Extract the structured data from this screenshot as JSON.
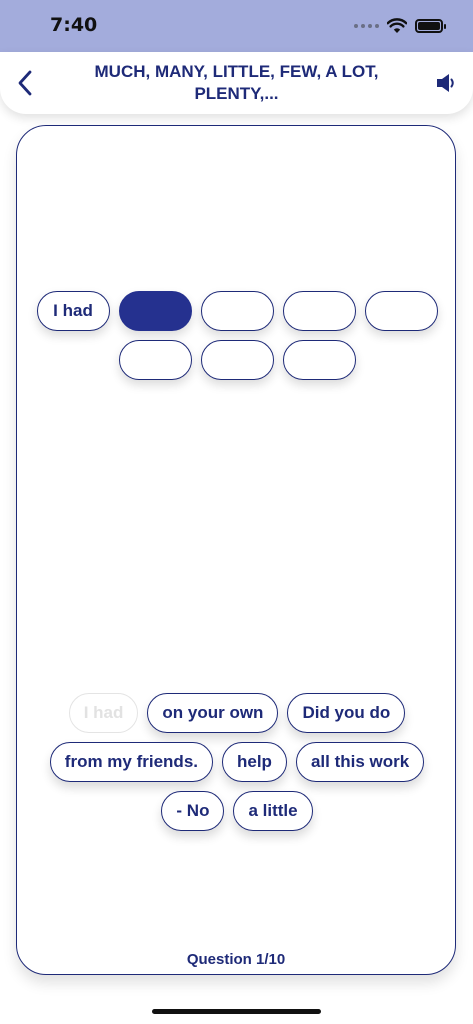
{
  "status_bar": {
    "time": "7:40",
    "icons": [
      "signal-icon",
      "wifi-icon",
      "battery-icon"
    ]
  },
  "header": {
    "title": "MUCH, MANY, LITTLE, FEW, A LOT, PLENTY,...",
    "back_icon": "chevron-left-icon",
    "sound_icon": "speaker-icon"
  },
  "answer_slots": {
    "rows": [
      [
        "I had",
        "",
        "",
        "",
        ""
      ],
      [
        "",
        "",
        ""
      ]
    ],
    "active_index": 1
  },
  "word_bank": {
    "rows": [
      [
        "I had",
        "on your own",
        "Did you do"
      ],
      [
        "from my friends.",
        "help",
        "all this work"
      ],
      [
        "- No",
        "a little"
      ]
    ],
    "used": [
      "I had"
    ]
  },
  "footer": {
    "question_counter": "Question 1/10"
  },
  "colors": {
    "accent": "#1e2a78",
    "active_slot": "#25318f",
    "status_bar_bg": "#a3acdc"
  }
}
